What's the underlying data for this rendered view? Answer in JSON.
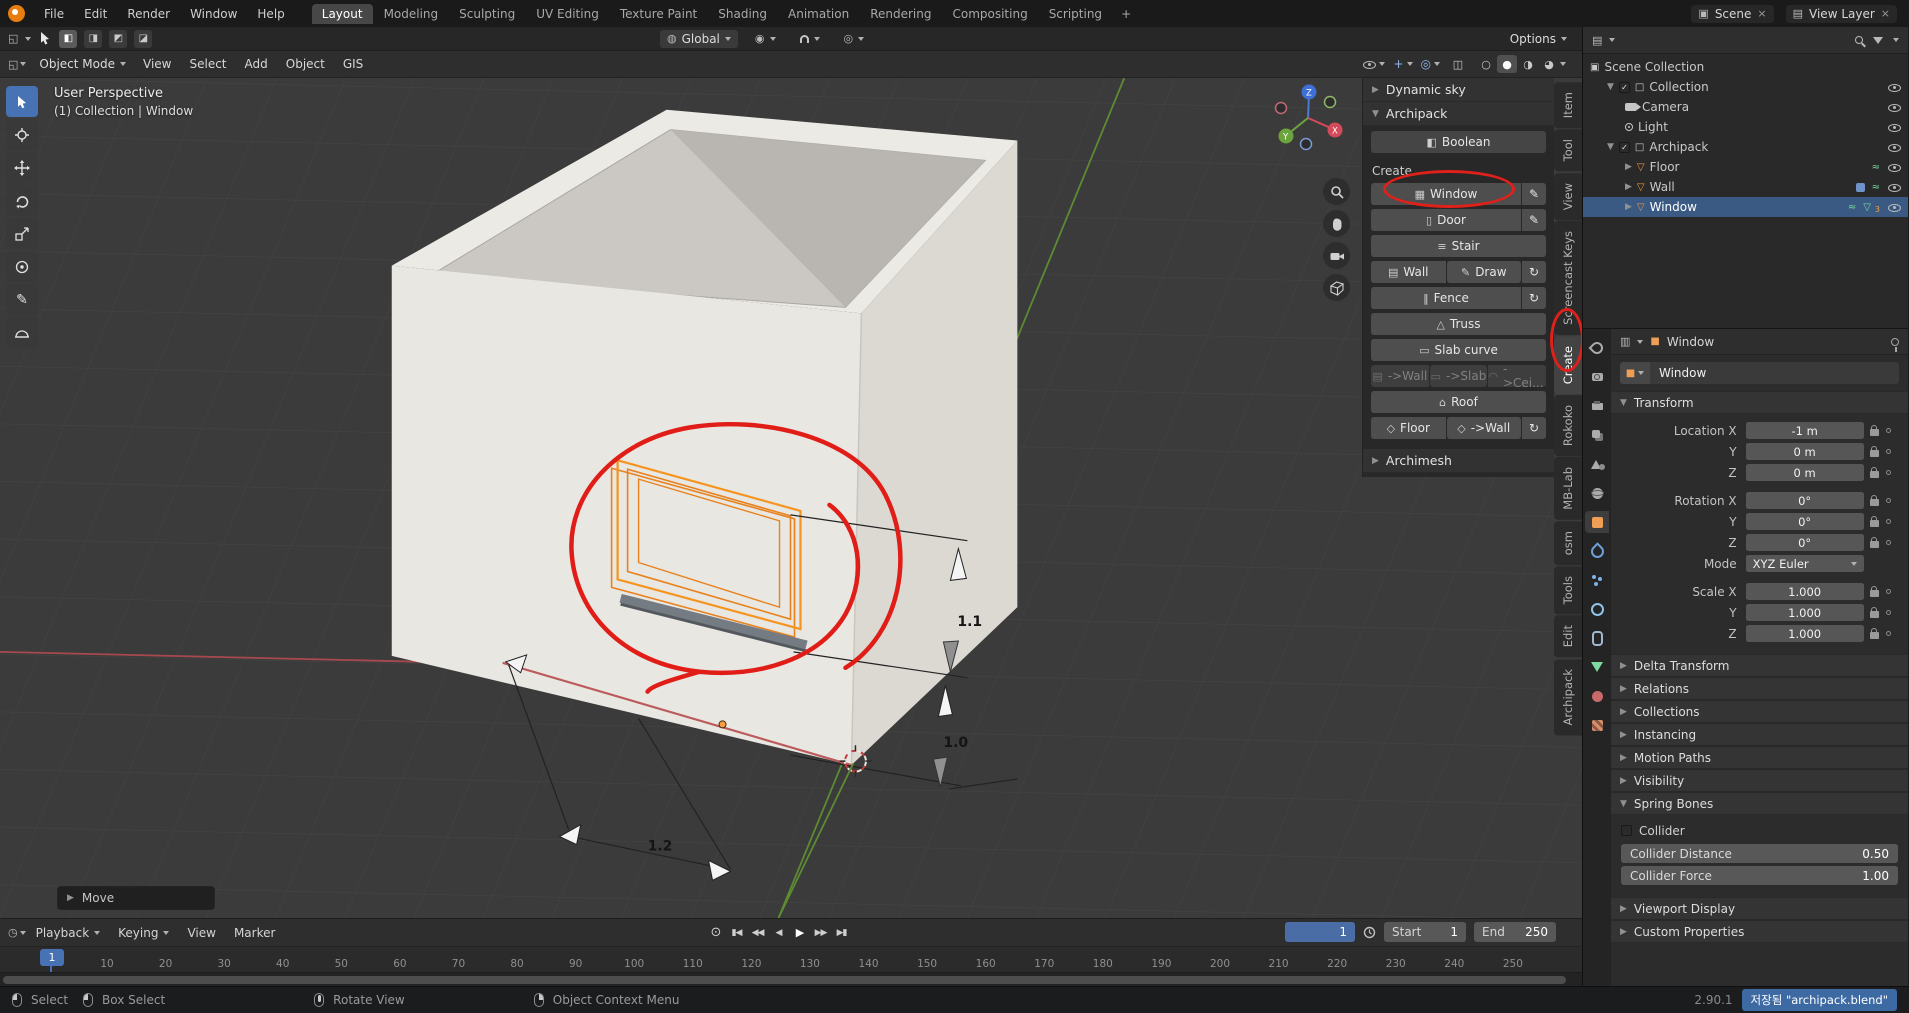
{
  "glyphs": {
    "collapsed": "▶",
    "expanded": "▼",
    "check": "✓",
    "close": "×",
    "pencil": "✎",
    "reload": "↻",
    "window": "▦",
    "door": "▯",
    "stair": "≡",
    "wall": "▤",
    "fence": "‖",
    "truss": "△",
    "slab": "▭",
    "ceiling": "◠",
    "roof": "⌂",
    "floor": "◇",
    "boolean": "◧",
    "mesh": "▽",
    "object": "■",
    "collection": "□",
    "scene_collection": "▣",
    "scene": "▣",
    "view_layer": "▤",
    "wireframe": "○",
    "solid": "●",
    "material_preview": "◑",
    "rendered": "◕",
    "xray": "◫",
    "proportional": "◎",
    "pivot": "◉",
    "globe": "◍",
    "mode1": "◧",
    "mode2": "◨",
    "mode3": "◩",
    "mode4": "◪",
    "editor_viewport": "◱",
    "editor_outliner": "▤",
    "editor_props": "▥",
    "editor_timeline": "◷",
    "record": "⊙",
    "jump_start": "▮◀",
    "prev_key": "◀◀",
    "play_rev": "◀",
    "play": "▶",
    "next_key": "▶▶",
    "jump_end": "▶▮",
    "curve": "≈"
  },
  "topbar": {
    "menus": [
      "File",
      "Edit",
      "Render",
      "Window",
      "Help"
    ],
    "workspaces": [
      "Layout",
      "Modeling",
      "Sculpting",
      "UV Editing",
      "Texture Paint",
      "Shading",
      "Animation",
      "Rendering",
      "Compositing",
      "Scripting"
    ],
    "add_workspace": "+",
    "scene_name": "Scene",
    "view_layer_name": "View Layer"
  },
  "tool_settings": {
    "orientation": "Global",
    "options": "Options"
  },
  "viewport_header": {
    "mode": "Object Mode",
    "menus": [
      "View",
      "Select",
      "Add",
      "Object",
      "GIS"
    ]
  },
  "viewport": {
    "overlay_title": "User Perspective",
    "overlay_subtitle": "(1) Collection | Window",
    "last_operator": "Move",
    "axis_x": "X",
    "axis_y": "Y",
    "axis_z": "Z",
    "dim_height": "1.1",
    "dim_offset": "1.0",
    "dim_width": "1.2"
  },
  "sidebar": {
    "panel_dynamic_sky": "Dynamic sky",
    "panel_archipack": "Archipack",
    "panel_archimesh": "Archimesh",
    "boolean": "Boolean",
    "create": "Create",
    "btn_window": "Window",
    "btn_door": "Door",
    "btn_stair": "Stair",
    "btn_wall": "Wall",
    "btn_draw": "Draw",
    "btn_fence": "Fence",
    "btn_truss": "Truss",
    "btn_slab_curve": "Slab curve",
    "btn_to_wall": "->Wall",
    "btn_to_slab": "->Slab",
    "btn_to_ceiling": "->Cei...",
    "btn_roof": "Roof",
    "btn_floor": "Floor",
    "btn_floor_to_wall": "->Wall",
    "tabs": [
      "Item",
      "Tool",
      "View",
      "Screencast Keys",
      "Create",
      "Rokoko",
      "MB-Lab",
      "osm",
      "Tools",
      "Edit",
      "Archipack"
    ],
    "active_tab": "Create"
  },
  "outliner": {
    "rows": [
      {
        "label": "Scene Collection"
      },
      {
        "label": "Collection"
      },
      {
        "label": "Camera"
      },
      {
        "label": "Light"
      },
      {
        "label": "Archipack"
      },
      {
        "label": "Floor"
      },
      {
        "label": "Wall"
      },
      {
        "label": "Window",
        "badge": "3"
      }
    ]
  },
  "properties": {
    "breadcrumb_object": "Window",
    "id_name": "Window",
    "panel_transform": "Transform",
    "transform_rows": [
      {
        "label": "Location X",
        "value": "-1 m"
      },
      {
        "label": "Y",
        "value": "0 m"
      },
      {
        "label": "Z",
        "value": "0 m"
      },
      {
        "label": "Rotation X",
        "value": "0°"
      },
      {
        "label": "Y",
        "value": "0°"
      },
      {
        "label": "Z",
        "value": "0°"
      },
      {
        "label": "Mode",
        "value": "XYZ Euler"
      },
      {
        "label": "Scale X",
        "value": "1.000"
      },
      {
        "label": "Y",
        "value": "1.000"
      },
      {
        "label": "Z",
        "value": "1.000"
      }
    ],
    "collapsed_panels": [
      "Delta Transform",
      "Relations",
      "Collections",
      "Instancing",
      "Motion Paths",
      "Visibility"
    ],
    "panel_spring_bones": "Spring Bones",
    "collider_label": "Collider",
    "spring_rows": [
      {
        "label": "Collider Distance",
        "value": "0.50"
      },
      {
        "label": "Collider Force",
        "value": "1.00"
      }
    ],
    "bottom_panels": [
      "Viewport Display",
      "Custom Properties"
    ]
  },
  "timeline": {
    "menus": [
      "Playback",
      "Keying",
      "View",
      "Marker"
    ],
    "current_frame": "1",
    "marker_frame": "1",
    "start_label": "Start",
    "start_value": "1",
    "end_label": "End",
    "end_value": "250",
    "ticks": [
      "10",
      "20",
      "30",
      "40",
      "50",
      "60",
      "70",
      "80",
      "90",
      "100",
      "110",
      "120",
      "130",
      "140",
      "150",
      "160",
      "170",
      "180",
      "190",
      "200",
      "210",
      "220",
      "230",
      "240",
      "250"
    ]
  },
  "statusbar": {
    "select": "Select",
    "box_select": "Box Select",
    "rotate_view": "Rotate View",
    "context_menu": "Object Context Menu",
    "version": "2.90.1",
    "saved": "저장됨 \"archipack.blend\""
  },
  "colors": {
    "accent_blue": "#4772b3",
    "object_orange": "#ee9e55",
    "axis_red": "#a8494f",
    "axis_green": "#5d8b33",
    "annotation_red": "#e0201a"
  }
}
